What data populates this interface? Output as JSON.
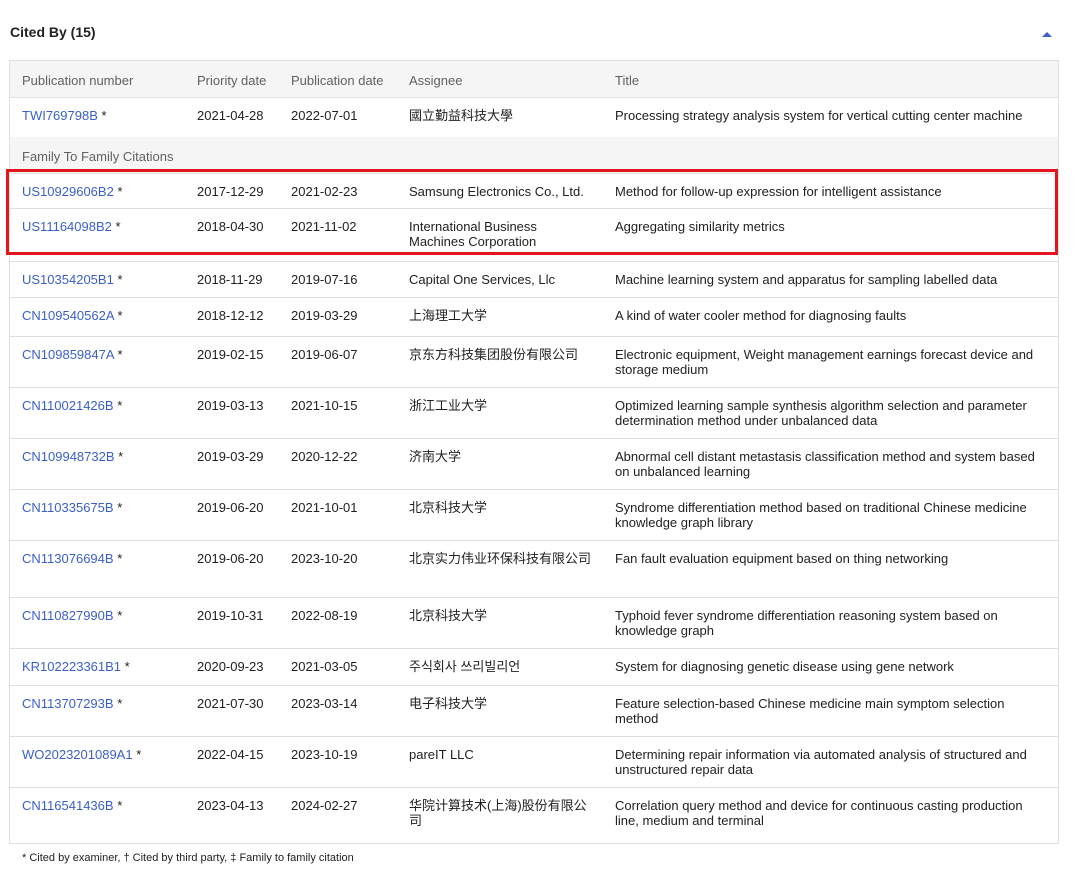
{
  "section": {
    "title": "Cited By (15)"
  },
  "columns": [
    "Publication number",
    "Priority date",
    "Publication date",
    "Assignee",
    "Title"
  ],
  "rows_top": [
    {
      "pub": "TWI769798B",
      "marker": "*",
      "priority": "2021-04-28",
      "published": "2022-07-01",
      "assignee": "國立勤益科技大學",
      "title": "Processing strategy analysis system for vertical cutting center machine"
    }
  ],
  "group_label": "Family To Family Citations",
  "rows_family": [
    {
      "pub": "US10929606B2",
      "marker": "*",
      "priority": "2017-12-29",
      "published": "2021-02-23",
      "assignee": "Samsung Electronics Co., Ltd.",
      "title": "Method for follow-up expression for intelligent assistance"
    },
    {
      "pub": "US11164098B2",
      "marker": "*",
      "priority": "2018-04-30",
      "published": "2021-11-02",
      "assignee": "International Business Machines Corporation",
      "title": "Aggregating similarity metrics"
    },
    {
      "pub": "US10354205B1",
      "marker": "*",
      "priority": "2018-11-29",
      "published": "2019-07-16",
      "assignee": "Capital One Services, Llc",
      "title": "Machine learning system and apparatus for sampling labelled data"
    },
    {
      "pub": "CN109540562A",
      "marker": "*",
      "priority": "2018-12-12",
      "published": "2019-03-29",
      "assignee": "上海理工大学",
      "title": "A kind of water cooler method for diagnosing faults"
    },
    {
      "pub": "CN109859847A",
      "marker": "*",
      "priority": "2019-02-15",
      "published": "2019-06-07",
      "assignee": "京东方科技集团股份有限公司",
      "title": "Electronic equipment, Weight management earnings forecast device and storage medium"
    },
    {
      "pub": "CN110021426B",
      "marker": "*",
      "priority": "2019-03-13",
      "published": "2021-10-15",
      "assignee": "浙江工业大学",
      "title": "Optimized learning sample synthesis algorithm selection and parameter determination method under unbalanced data"
    },
    {
      "pub": "CN109948732B",
      "marker": "*",
      "priority": "2019-03-29",
      "published": "2020-12-22",
      "assignee": "济南大学",
      "title": "Abnormal cell distant metastasis classification method and system based on unbalanced learning"
    },
    {
      "pub": "CN110335675B",
      "marker": "*",
      "priority": "2019-06-20",
      "published": "2021-10-01",
      "assignee": "北京科技大学",
      "title": "Syndrome differentiation method based on traditional Chinese medicine knowledge graph library"
    },
    {
      "pub": "CN113076694B",
      "marker": "*",
      "priority": "2019-06-20",
      "published": "2023-10-20",
      "assignee": "北京实力伟业环保科技有限公司",
      "title": "Fan fault evaluation equipment based on thing networking"
    },
    {
      "pub": "CN110827990B",
      "marker": "*",
      "priority": "2019-10-31",
      "published": "2022-08-19",
      "assignee": "北京科技大学",
      "title": "Typhoid fever syndrome differentiation reasoning system based on knowledge graph"
    },
    {
      "pub": "KR102223361B1",
      "marker": "*",
      "priority": "2020-09-23",
      "published": "2021-03-05",
      "assignee": "주식회사 쓰리빌리언",
      "title": "System for diagnosing genetic disease using gene network"
    },
    {
      "pub": "CN113707293B",
      "marker": "*",
      "priority": "2021-07-30",
      "published": "2023-03-14",
      "assignee": "电子科技大学",
      "title": "Feature selection-based Chinese medicine main symptom selection method"
    },
    {
      "pub": "WO2023201089A1",
      "marker": "*",
      "priority": "2022-04-15",
      "published": "2023-10-19",
      "assignee": "pareIT LLC",
      "title": "Determining repair information via automated analysis of structured and unstructured repair data"
    },
    {
      "pub": "CN116541436B",
      "marker": "*",
      "priority": "2023-04-13",
      "published": "2024-02-27",
      "assignee": "华院计算技术(上海)股份有限公司",
      "title": "Correlation query method and device for continuous casting production line, medium and terminal"
    }
  ],
  "footnote": "* Cited by examiner, † Cited by third party, ‡ Family to family citation",
  "colors": {
    "link": "#3b5fc9",
    "highlight": "#e4161d",
    "header_bg": "#f5f5f5"
  }
}
